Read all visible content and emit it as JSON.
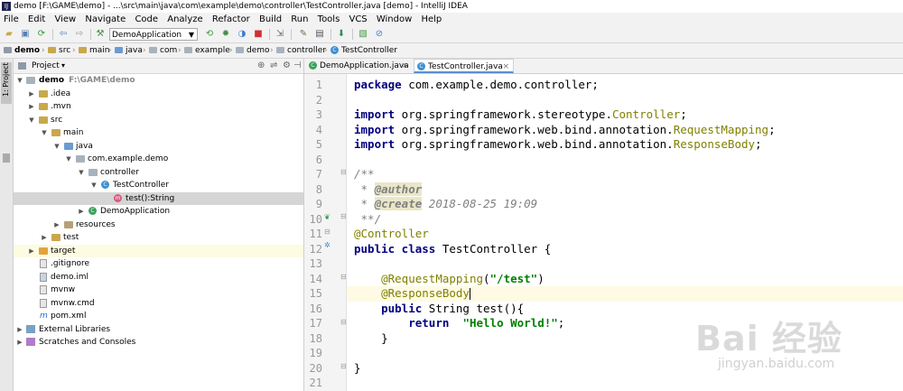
{
  "window": {
    "title": "demo [F:\\GAME\\demo] - ...\\src\\main\\java\\com\\example\\demo\\controller\\TestController.java [demo] - IntelliJ IDEA"
  },
  "menu": [
    "File",
    "Edit",
    "View",
    "Navigate",
    "Code",
    "Analyze",
    "Refactor",
    "Build",
    "Run",
    "Tools",
    "VCS",
    "Window",
    "Help"
  ],
  "toolbar": {
    "run_config": "DemoApplication"
  },
  "breadcrumbs": [
    "demo",
    "src",
    "main",
    "java",
    "com",
    "example",
    "demo",
    "controller",
    "TestController"
  ],
  "side_tab": "1: Project",
  "project_panel": {
    "title": "Project"
  },
  "tree": [
    {
      "label": "demo",
      "path": "F:\\GAME\\demo",
      "icon": "module-folder-icon",
      "arrow": "down"
    },
    {
      "label": ".idea",
      "path": "",
      "icon": "folder-icon",
      "arrow": "right"
    },
    {
      "label": ".mvn",
      "path": "",
      "icon": "folder-icon",
      "arrow": "right"
    },
    {
      "label": "src",
      "path": "",
      "icon": "folder-icon",
      "arrow": "down"
    },
    {
      "label": "main",
      "path": "",
      "icon": "folder-icon",
      "arrow": "down"
    },
    {
      "label": "java",
      "path": "",
      "icon": "source-folder-icon",
      "arrow": "down"
    },
    {
      "label": "com.example.demo",
      "path": "",
      "icon": "package-icon",
      "arrow": "down"
    },
    {
      "label": "controller",
      "path": "",
      "icon": "package-icon",
      "arrow": "down"
    },
    {
      "label": "TestController",
      "path": "",
      "icon": "class-icon",
      "arrow": "down"
    },
    {
      "label": "test():String",
      "path": "",
      "icon": "method-icon",
      "arrow": ""
    },
    {
      "label": "DemoApplication",
      "path": "",
      "icon": "spring-class-icon",
      "arrow": "right"
    },
    {
      "label": "resources",
      "path": "",
      "icon": "resources-folder-icon",
      "arrow": "right"
    },
    {
      "label": "test",
      "path": "",
      "icon": "folder-icon",
      "arrow": "right"
    },
    {
      "label": "target",
      "path": "",
      "icon": "excluded-folder-icon",
      "arrow": "right"
    },
    {
      "label": ".gitignore",
      "path": "",
      "icon": "file-icon",
      "arrow": ""
    },
    {
      "label": "demo.iml",
      "path": "",
      "icon": "iml-file-icon",
      "arrow": ""
    },
    {
      "label": "mvnw",
      "path": "",
      "icon": "file-icon",
      "arrow": ""
    },
    {
      "label": "mvnw.cmd",
      "path": "",
      "icon": "file-icon",
      "arrow": ""
    },
    {
      "label": "pom.xml",
      "path": "",
      "icon": "maven-icon",
      "arrow": ""
    },
    {
      "label": "External Libraries",
      "path": "",
      "icon": "libraries-icon",
      "arrow": "right"
    },
    {
      "label": "Scratches and Consoles",
      "path": "",
      "icon": "scratches-icon",
      "arrow": "right"
    }
  ],
  "tabs": [
    {
      "label": "DemoApplication.java"
    },
    {
      "label": "TestController.java"
    }
  ],
  "line_numbers": [
    "1",
    "2",
    "3",
    "4",
    "5",
    "6",
    "7",
    "8",
    "9",
    "10",
    "11",
    "12",
    "13",
    "14",
    "15",
    "16",
    "17",
    "18",
    "19",
    "20",
    "21"
  ],
  "code": [
    [
      [
        "kw",
        "package"
      ],
      [
        "plain",
        " com.example.demo.controller;"
      ]
    ],
    [],
    [
      [
        "kw",
        "import"
      ],
      [
        "plain",
        " org.springframework.stereotype."
      ],
      [
        "ann",
        "Controller"
      ],
      [
        "plain",
        ";"
      ]
    ],
    [
      [
        "kw",
        "import"
      ],
      [
        "plain",
        " org.springframework.web.bind.annotation."
      ],
      [
        "ann",
        "RequestMapping"
      ],
      [
        "plain",
        ";"
      ]
    ],
    [
      [
        "kw",
        "import"
      ],
      [
        "plain",
        " org.springframework.web.bind.annotation."
      ],
      [
        "ann",
        "ResponseBody"
      ],
      [
        "plain",
        ";"
      ]
    ],
    [],
    [
      [
        "cmt",
        "/**"
      ]
    ],
    [
      [
        "cmt",
        " * "
      ],
      [
        "tag",
        "@author"
      ]
    ],
    [
      [
        "cmt",
        " * "
      ],
      [
        "tag",
        "@create"
      ],
      [
        "cmt",
        " 2018-08-25 19:09"
      ]
    ],
    [
      [
        "cmt",
        " **/"
      ]
    ],
    [
      [
        "ann",
        "@Controller"
      ]
    ],
    [
      [
        "kw",
        "public class"
      ],
      [
        "plain",
        " TestController {"
      ]
    ],
    [],
    [
      [
        "plain",
        "    "
      ],
      [
        "ann",
        "@RequestMapping"
      ],
      [
        "plain",
        "("
      ],
      [
        "str",
        "\"/test\""
      ],
      [
        "plain",
        ")"
      ]
    ],
    [
      [
        "plain",
        "    "
      ],
      [
        "ann",
        "@ResponseBody"
      ]
    ],
    [
      [
        "plain",
        "    "
      ],
      [
        "kw",
        "public"
      ],
      [
        "plain",
        " String test(){"
      ]
    ],
    [
      [
        "plain",
        "        "
      ],
      [
        "kw",
        "return"
      ],
      [
        "plain",
        "  "
      ],
      [
        "str",
        "\"Hello World!\""
      ],
      [
        "plain",
        ";"
      ]
    ],
    [
      [
        "plain",
        "    }"
      ]
    ],
    [],
    [
      [
        "plain",
        "}"
      ]
    ],
    []
  ],
  "watermark": {
    "main": "Bai 经验",
    "sub": "jingyan.baidu.com"
  }
}
